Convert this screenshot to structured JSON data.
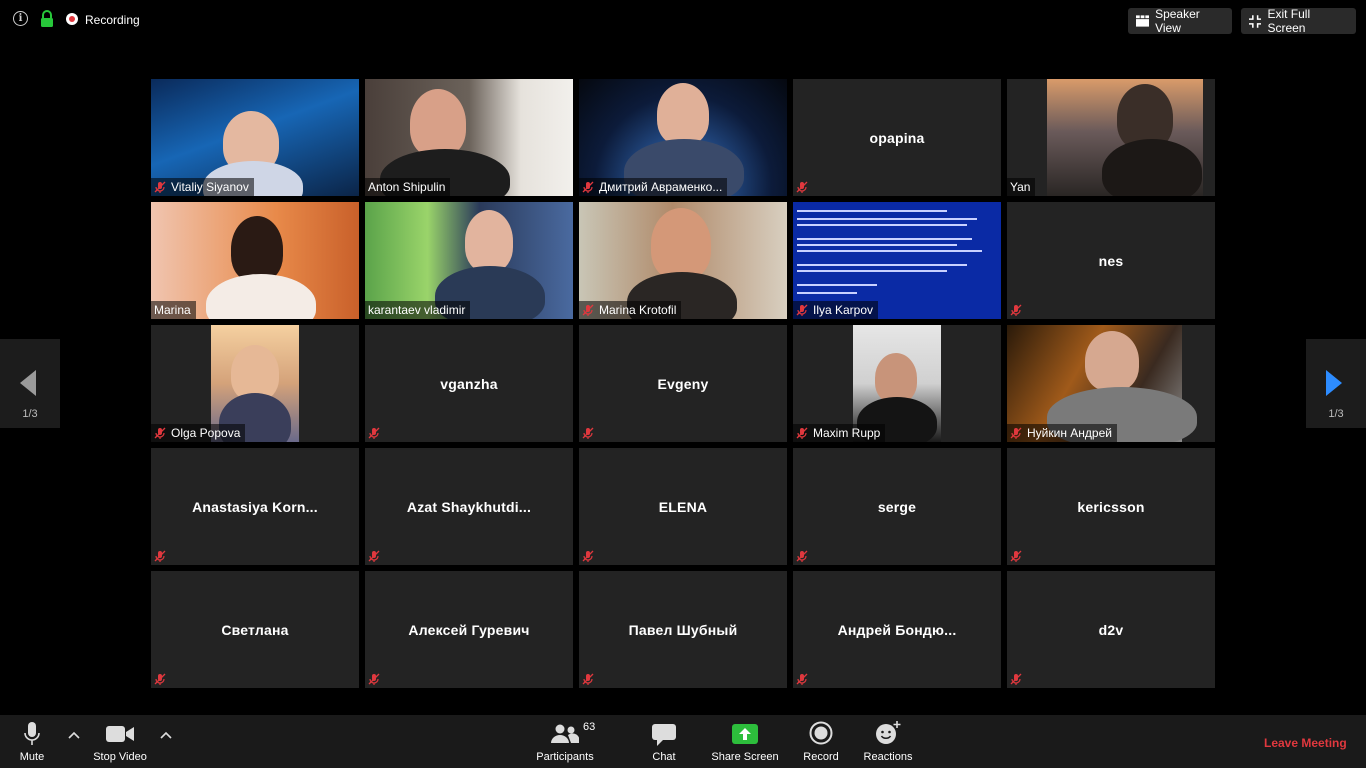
{
  "top": {
    "recording": "Recording",
    "speaker_view": "Speaker View",
    "exit_full_screen": "Exit Full Screen"
  },
  "tiles": [
    {
      "name": "Vitaliy Siyanov"
    },
    {
      "name": "Anton Shipulin"
    },
    {
      "name": "Дмитрий Авраменко..."
    },
    {
      "name": "opapina"
    },
    {
      "name": "Yan"
    },
    {
      "name": "Marina"
    },
    {
      "name": "karantaev vladimir"
    },
    {
      "name": "Marina Krotofil"
    },
    {
      "name": "Ilya Karpov"
    },
    {
      "name": "nes"
    },
    {
      "name": "Olga Popova"
    },
    {
      "name": "vganzha"
    },
    {
      "name": "Evgeny"
    },
    {
      "name": "Maxim Rupp"
    },
    {
      "name": "Нуйкин Андрей"
    },
    {
      "name": "Anastasiya  Korn..."
    },
    {
      "name": "Azat  Shaykhutdi..."
    },
    {
      "name": "ELENA"
    },
    {
      "name": "serge"
    },
    {
      "name": "kericsson"
    },
    {
      "name": "Светлана"
    },
    {
      "name": "Алексей Гуревич"
    },
    {
      "name": "Павел Шубный"
    },
    {
      "name": "Андрей  Бондю..."
    },
    {
      "name": "d2v"
    }
  ],
  "pager": {
    "left": "1/3",
    "right": "1/3"
  },
  "toolbar": {
    "mute": "Mute",
    "stop_video": "Stop Video",
    "participants": "Participants",
    "participants_count": "63",
    "chat": "Chat",
    "share_screen": "Share Screen",
    "record": "Record",
    "reactions": "Reactions",
    "leave": "Leave Meeting"
  },
  "colors": {
    "accent_share": "#2dbe3c",
    "leave": "#e0383e",
    "speaking_outline": "#d9e84e",
    "tile_bg": "#232323"
  }
}
